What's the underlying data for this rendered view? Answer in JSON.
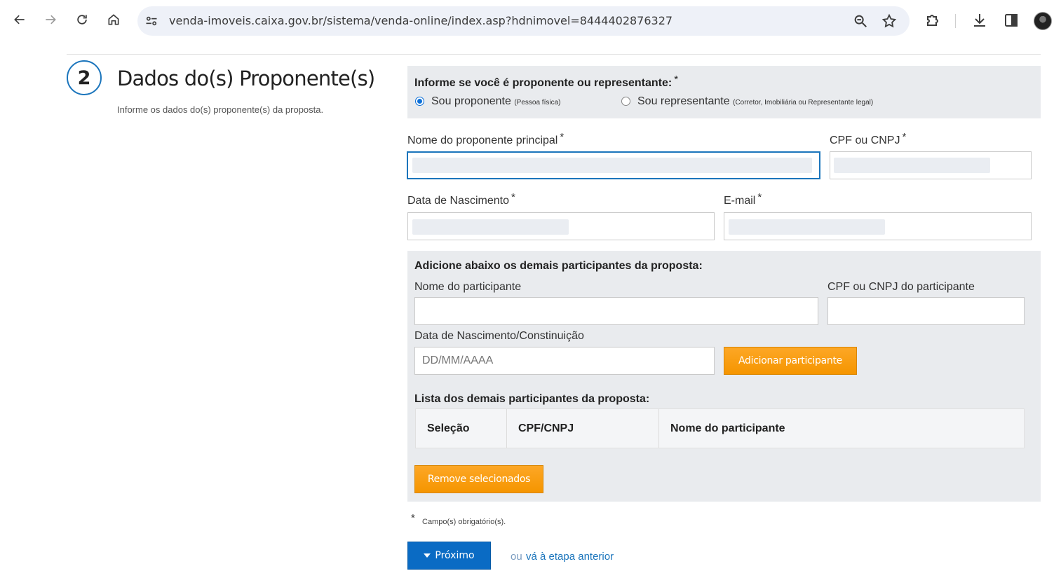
{
  "browser": {
    "url": "venda-imoveis.caixa.gov.br/sistema/venda-online/index.asp?hdnimovel=8444402876327",
    "icons": [
      "back-icon",
      "forward-icon",
      "reload-icon",
      "home-icon",
      "site-settings-icon",
      "zoom-icon",
      "bookmark-star-icon",
      "extensions-icon",
      "download-icon",
      "side-panel-icon",
      "profile-avatar"
    ]
  },
  "step": {
    "number": "2",
    "title": "Dados do(s) Proponente(s)",
    "subtitle": "Informe os dados do(s) proponente(s) da proposta."
  },
  "role": {
    "question": "Informe se você é proponente ou representante:",
    "required_mark": "*",
    "options": [
      {
        "label": "Sou proponente",
        "note": "(Pessoa física)",
        "selected": true
      },
      {
        "label": "Sou representante",
        "note": "(Corretor, Imobiliária ou Representante legal)",
        "selected": false
      }
    ]
  },
  "proponent": {
    "name_label": "Nome do proponente principal",
    "cpf_label": "CPF ou CNPJ",
    "birth_label": "Data de Nascimento",
    "email_label": "E-mail",
    "required_mark": "*"
  },
  "participants": {
    "title": "Adicione abaixo os demais participantes da proposta:",
    "name_label": "Nome do participante",
    "cpf_label": "CPF ou CNPJ do participante",
    "birth_label": "Data de Nascimento/Constinuição",
    "birth_placeholder": "DD/MM/AAAA",
    "add_button": "Adicionar participante",
    "list_title": "Lista dos demais participantes da proposta:",
    "columns": [
      "Seleção",
      "CPF/CNPJ",
      "Nome do participante"
    ],
    "remove_button": "Remove selecionados"
  },
  "footer": {
    "required_star": "*",
    "required_note": "Campo(s) obrigatório(s).",
    "next_button": "Próximo",
    "or_text": "ou",
    "back_link": "vá à etapa anterior"
  },
  "colors": {
    "accent_blue": "#1b75bc",
    "button_blue": "#0a6bc4",
    "button_orange": "#f59500",
    "panel_gray": "#e9ebee"
  }
}
